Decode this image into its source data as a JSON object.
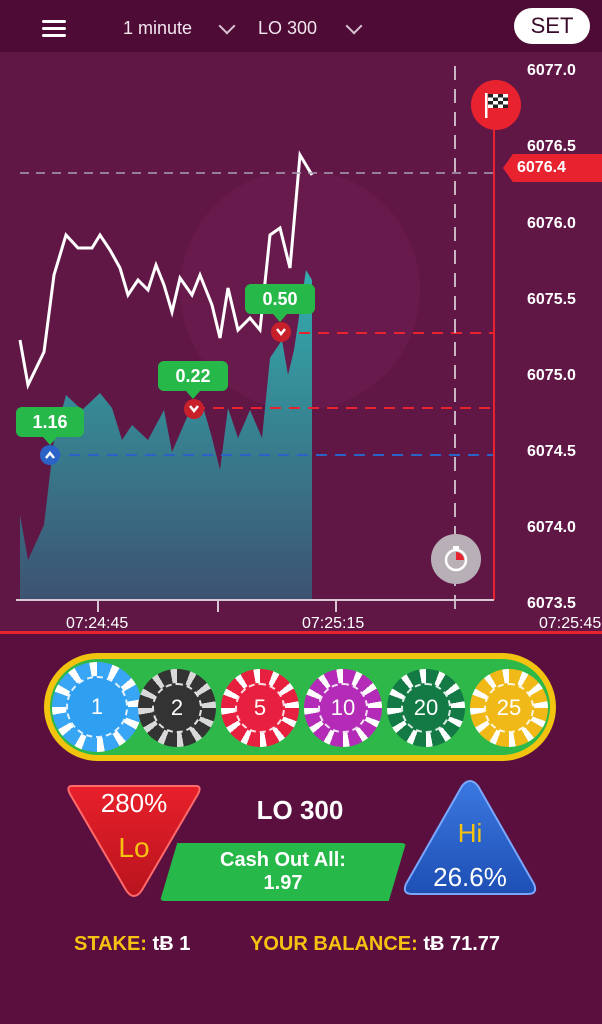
{
  "header": {
    "interval": "1 minute",
    "symbol": "LO 300",
    "set_label": "SET"
  },
  "chart": {
    "price_labels": [
      "6077.0",
      "6076.5",
      "6076.0",
      "6075.5",
      "6075.0",
      "6074.5",
      "6074.0",
      "6073.5"
    ],
    "current_price": "6076.4",
    "time_labels": [
      "07:24:45",
      "07:25:15",
      "07:25:45"
    ],
    "bet_tags": [
      "1.16",
      "0.22",
      "0.50"
    ],
    "colors": {
      "line": "#ffffff",
      "area": "#2ab0b4",
      "up": "#2a62c8",
      "down": "#e8232f"
    }
  },
  "chips": [
    "1",
    "2",
    "5",
    "10",
    "20",
    "25"
  ],
  "lo": {
    "percent": "280%",
    "label": "Lo"
  },
  "hi": {
    "label": "Hi",
    "percent": "26.6%"
  },
  "center_title": "LO 300",
  "cashout": {
    "line1": "Cash Out All:",
    "line2": "1.97"
  },
  "footer": {
    "stake_label": "STAKE:",
    "stake_value": "tɃ 1",
    "balance_label": "YOUR BALANCE:",
    "balance_value": "tɃ 71.77"
  }
}
